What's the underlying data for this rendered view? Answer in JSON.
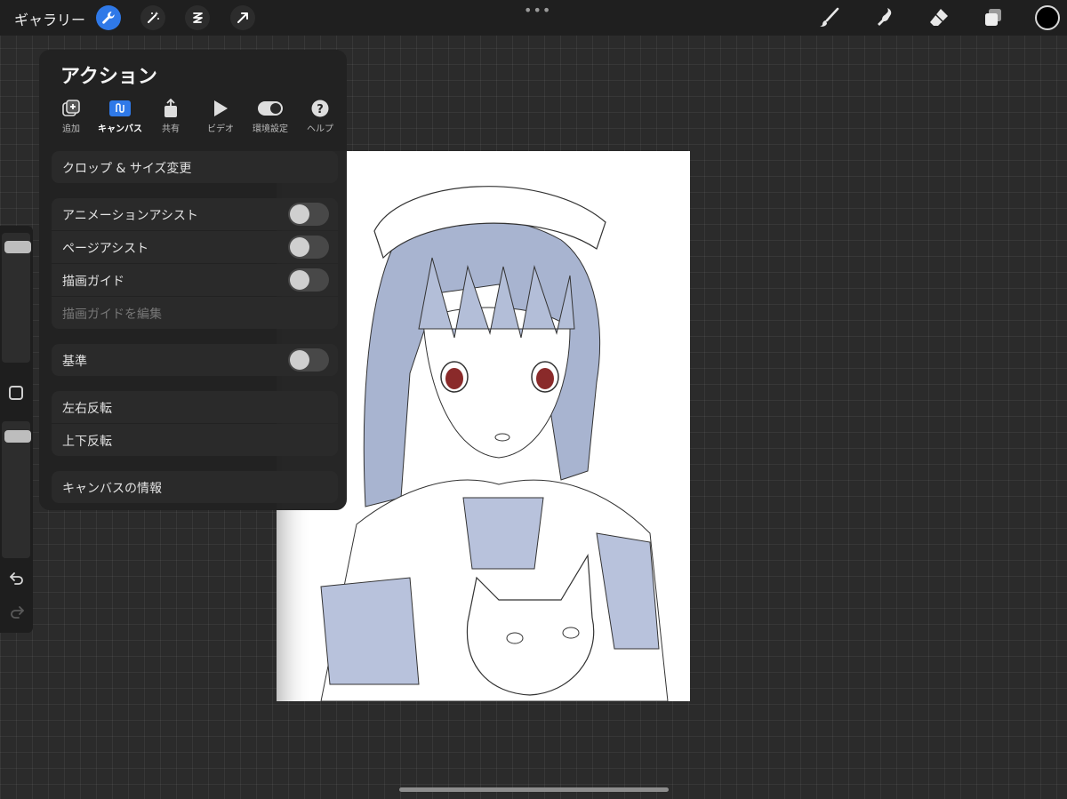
{
  "topbar": {
    "gallery_label": "ギャラリー",
    "left_tools": [
      "wrench-icon",
      "magic-wand-icon",
      "selection-icon",
      "transform-arrow-icon"
    ],
    "right_tools": [
      "brush-icon",
      "smudge-icon",
      "eraser-icon",
      "layers-icon"
    ],
    "current_color": "#000000",
    "accent_color": "#2f79e8"
  },
  "panel": {
    "title": "アクション",
    "tabs": [
      {
        "label": "追加",
        "icon": "add-icon"
      },
      {
        "label": "キャンバス",
        "icon": "canvas-icon"
      },
      {
        "label": "共有",
        "icon": "share-icon"
      },
      {
        "label": "ビデオ",
        "icon": "play-icon"
      },
      {
        "label": "環境設定",
        "icon": "toggle-icon"
      },
      {
        "label": "ヘルプ",
        "icon": "help-icon"
      }
    ],
    "active_tab": "キャンバス",
    "crop_label": "クロップ & サイズ変更",
    "animation_assist_label": "アニメーションアシスト",
    "animation_assist_on": false,
    "page_assist_label": "ページアシスト",
    "page_assist_on": false,
    "drawing_guide_label": "描画ガイド",
    "drawing_guide_on": false,
    "edit_drawing_guide_label": "描画ガイドを編集",
    "reference_label": "基準",
    "reference_on": false,
    "flip_horizontal_label": "左右反転",
    "flip_vertical_label": "上下反転",
    "canvas_info_label": "キャンバスの情報"
  },
  "sidebar": {
    "size_level": 0.95,
    "opacity_level": 0.95,
    "icons": [
      "modifier-square-icon",
      "undo-icon",
      "redo-icon"
    ]
  },
  "canvas": {
    "background": "#ffffff"
  }
}
